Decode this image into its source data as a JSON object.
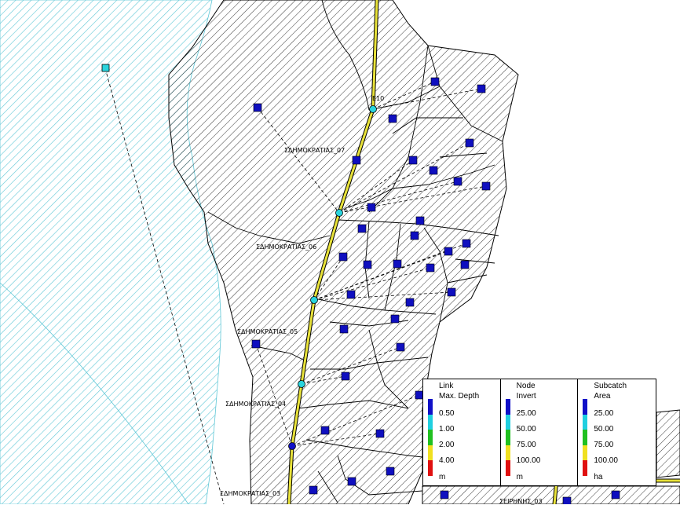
{
  "map": {
    "labels": {
      "node_e10": "E10",
      "d07": "ΣΔΗΜΟΚΡΑΤΙΑΣ_07",
      "d06": "ΣΔΗΜΟΚΡΑΤΙΑΣ_06",
      "d05": "ΣΔΗΜΟΚΡΑΤΙΑΣ_05",
      "d04": "ΣΔΗΜΟΚΡΑΤΙΑΣ_04",
      "d03": "ΣΔΗΜΟΚΡΑΤΙΑΣ_03",
      "bottom_partial": "ΣΕΙΡΗΝΗΣ_03"
    },
    "colors": {
      "water_hatch": "#5fc7d6",
      "catchment_hatch": "#000000",
      "subcatch_marker": "#0f0fbf",
      "node_marker": "#2ad4dd",
      "link": "#e8e23a",
      "outfall_marker": "#2ad4dd"
    }
  },
  "legend": {
    "panels": [
      {
        "title": "Link",
        "subtitle": "Max. Depth",
        "values": [
          "0.50",
          "1.00",
          "2.00",
          "4.00"
        ],
        "unit": "m"
      },
      {
        "title": "Node",
        "subtitle": "Invert",
        "values": [
          "25.00",
          "50.00",
          "75.00",
          "100.00"
        ],
        "unit": "m"
      },
      {
        "title": "Subcatch",
        "subtitle": "Area",
        "values": [
          "25.00",
          "50.00",
          "75.00",
          "100.00"
        ],
        "unit": "ha"
      }
    ],
    "scale_colors": [
      "#1010c8",
      "#20cfe0",
      "#20c020",
      "#f0e020",
      "#e01010"
    ]
  }
}
